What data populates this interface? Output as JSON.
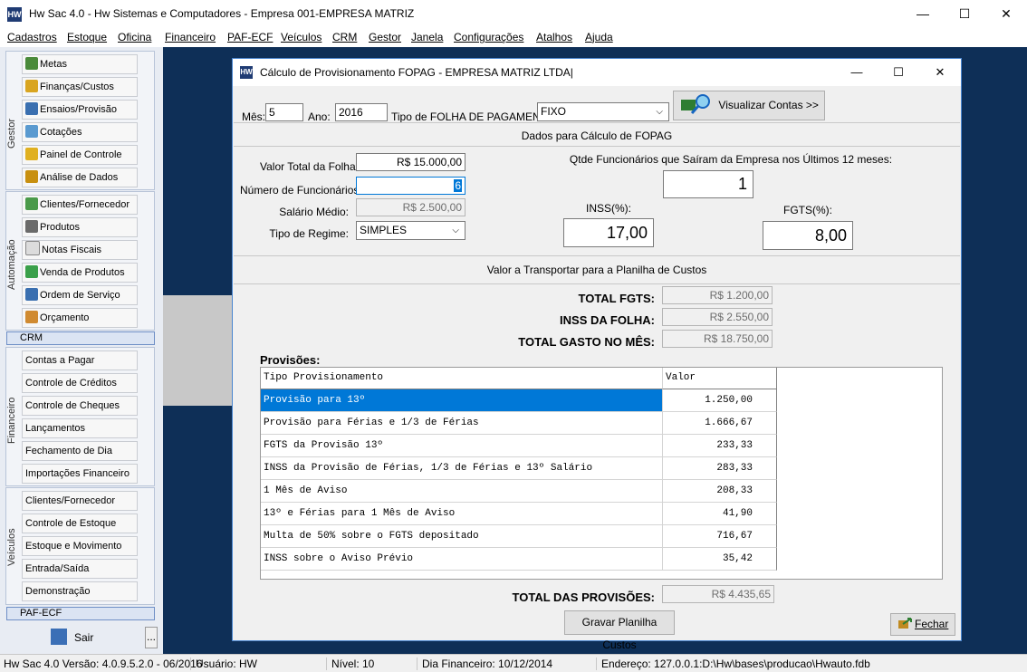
{
  "app": {
    "title": "Hw Sac 4.0 - Hw Sistemas e Computadores - Empresa 001-EMPRESA MATRIZ",
    "icon_text": "HW",
    "controls": {
      "minimize": "—",
      "maximize": "☐",
      "close": "✕"
    }
  },
  "menu": [
    "Cadastros",
    "Estoque",
    "Oficina",
    "Financeiro",
    "PAF-ECF",
    "Veículos",
    "CRM",
    "Gestor",
    "Janela",
    "Configurações",
    "Atalhos",
    "Ajuda"
  ],
  "sidebar": {
    "gestor": {
      "label": "Gestor",
      "items": [
        "Metas",
        "Finanças/Custos",
        "Ensaios/Provisão",
        "Cotações",
        "Painel de Controle",
        "Análise de Dados"
      ]
    },
    "automacao": {
      "label": "Automação",
      "items": [
        "Clientes/Fornecedor",
        "Produtos",
        "Notas Fiscais",
        "Venda de Produtos",
        "Ordem de Serviço",
        "Orçamento"
      ]
    },
    "crm": {
      "label": "CRM"
    },
    "financeiro": {
      "label": "Financeiro",
      "items": [
        "Contas a Pagar",
        "Controle de Créditos",
        "Controle de Cheques",
        "Lançamentos",
        "Fechamento de Dia",
        "Importações Financeiro"
      ]
    },
    "veiculos": {
      "label": "Veículos",
      "items": [
        "Clientes/Fornecedor",
        "Controle de Estoque",
        "Estoque e Movimento",
        "Entrada/Saída",
        "Demonstração"
      ]
    },
    "paf": {
      "label": "PAF-ECF"
    },
    "sair": "Sair",
    "more": "..."
  },
  "dialog": {
    "title": "Cálculo de Provisionamento FOPAG - EMPRESA MATRIZ LTDA|",
    "mes_label": "Mês:",
    "mes_value": "5",
    "ano_label": "Ano:",
    "ano_value": "2016",
    "tipo_folha_label": "Tipo de FOLHA DE PAGAMENTO",
    "tipo_folha_value": "FIXO",
    "visualizar_label": "Visualizar Contas >>",
    "section1": "Dados para Cálculo de FOPAG",
    "valor_total_label": "Valor Total da Folha:",
    "valor_total_value": "R$ 15.000,00",
    "num_func_label": "Número de Funcionários:",
    "num_func_value": "6",
    "salario_label": "Salário Médio:",
    "salario_value": "R$ 2.500,00",
    "regime_label": "Tipo de Regime:",
    "regime_value": "SIMPLES",
    "qtde_label": "Qtde Funcionários que Saíram da Empresa nos Últimos 12 meses:",
    "qtde_value": "1",
    "inss_label": "INSS(%):",
    "inss_value": "17,00",
    "fgts_label": "FGTS(%):",
    "fgts_value": "8,00",
    "section2": "Valor a Transportar para a Planilha de Custos",
    "total_fgts_label": "TOTAL FGTS:",
    "total_fgts_value": "R$ 1.200,00",
    "inss_folha_label": "INSS DA FOLHA:",
    "inss_folha_value": "R$ 2.550,00",
    "total_gasto_label": "TOTAL GASTO NO MÊS:",
    "total_gasto_value": "R$ 18.750,00",
    "provisoes_label": "Provisões:",
    "grid_headers": [
      "Tipo Provisionamento",
      "Valor"
    ],
    "grid_rows": [
      {
        "tipo": "Provisão para 13º",
        "valor": "1.250,00"
      },
      {
        "tipo": "Provisão para Férias e 1/3 de Férias",
        "valor": "1.666,67"
      },
      {
        "tipo": "FGTS da Provisão 13º",
        "valor": "233,33"
      },
      {
        "tipo": "INSS da Provisão de Férias, 1/3 de Férias e 13º Salário",
        "valor": "283,33"
      },
      {
        "tipo": "1 Mês de Aviso",
        "valor": "208,33"
      },
      {
        "tipo": "13º e Férias para 1 Mês de Aviso",
        "valor": "41,90"
      },
      {
        "tipo": "Multa de 50% sobre o FGTS depositado",
        "valor": "716,67"
      },
      {
        "tipo": "INSS sobre o Aviso Prévio",
        "valor": "35,42"
      }
    ],
    "total_prov_label": "TOTAL DAS PROVISÕES:",
    "total_prov_value": "R$ 4.435,65",
    "gravar_label": "Gravar Planilha Custos",
    "fechar_label": "Fechar",
    "combo_arrow": "⌵"
  },
  "status": {
    "versao": "Hw Sac 4.0 Versão: 4.0.9.5.2.0 - 06/2016",
    "usuario": "Usuário: HW",
    "nivel": "Nível: 10",
    "dia": "Dia Financeiro: 10/12/2014",
    "endereco": "Endereço: 127.0.0.1:D:\\Hw\\bases\\producao\\Hwauto.fdb"
  },
  "colors": {
    "workspace": "#0e2f57",
    "selection": "#0078d7",
    "dialog_border": "#4a86d0"
  }
}
